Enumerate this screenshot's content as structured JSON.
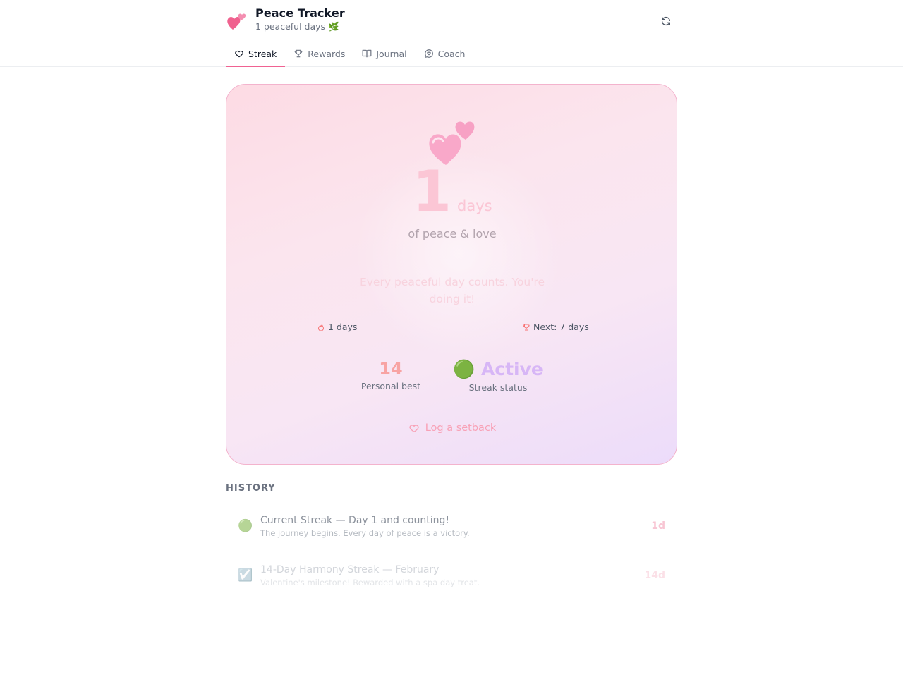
{
  "header": {
    "title": "Peace Tracker",
    "subtitle": "1 peaceful days 🌿",
    "brand_icon": "two-hearts-icon",
    "refresh_icon": "refresh-icon"
  },
  "tabs": [
    {
      "label": "Streak",
      "icon": "heart-icon",
      "active": true
    },
    {
      "label": "Rewards",
      "icon": "trophy-icon",
      "active": false
    },
    {
      "label": "Journal",
      "icon": "book-open-icon",
      "active": false
    },
    {
      "label": "Coach",
      "icon": "chat-heart-icon",
      "active": false
    }
  ],
  "streak": {
    "count": "1",
    "unit": "days",
    "label": "of peace & love",
    "quote": "Every peaceful day counts. You're doing it!",
    "current_meta": "1 days",
    "next_meta": "Next: 7 days",
    "best_value": "14",
    "best_label": "Personal best",
    "status_value": "🟢 Active",
    "status_label": "Streak status",
    "setback_label": "Log a setback"
  },
  "history": {
    "title": "HISTORY",
    "items": [
      {
        "icon": "🟢",
        "title": "Current Streak — Day 1 and counting!",
        "desc": "The journey begins. Every day of peace is a victory.",
        "badge": "1d"
      },
      {
        "icon": "☑️",
        "title": "14-Day Harmony Streak — February",
        "desc": "Valentine's milestone! Rewarded with a spa day treat.",
        "badge": "14d"
      }
    ]
  },
  "colors": {
    "accent": "#f06292",
    "card_pink": "#fddbe4",
    "card_lavender": "#ecdcfa",
    "best": "#f8a3a3",
    "status": "#d7b6f6"
  }
}
